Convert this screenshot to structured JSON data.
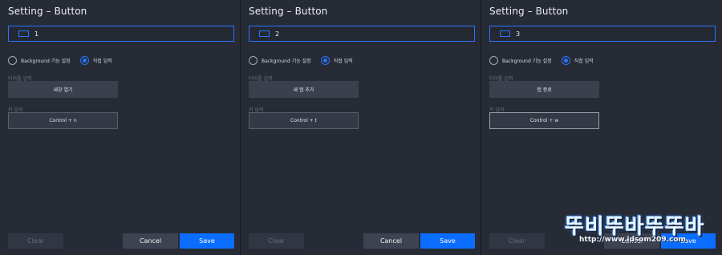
{
  "panels": [
    {
      "title": "Setting – Button",
      "button_id": "1",
      "radio_background": "Background 기능 설정",
      "radio_direct": "직접 입력",
      "title_label": "타이틀 입력",
      "title_value": "새창 열기",
      "key_label": "키 입력",
      "key_value": "Control + n",
      "clear": "Clear",
      "cancel": "Cancel",
      "save": "Save"
    },
    {
      "title": "Setting – Button",
      "button_id": "2",
      "radio_background": "Background 기능 설정",
      "radio_direct": "직접 입력",
      "title_label": "타이틀 입력",
      "title_value": "새 탭 추가",
      "key_label": "키 입력",
      "key_value": "Control + t",
      "clear": "Clear",
      "cancel": "Cancel",
      "save": "Save"
    },
    {
      "title": "Setting – Button",
      "button_id": "3",
      "radio_background": "Background 기능 설정",
      "radio_direct": "직접 입력",
      "title_label": "타이틀 입력",
      "title_value": "탭 종료",
      "key_label": "키 입력",
      "key_value": "Control + w",
      "clear": "Clear",
      "cancel": "Cancel",
      "save": "Save"
    }
  ],
  "watermark": {
    "logo_text": "뚜비뚜바뚜뚜바",
    "url": "http://www.idsom209.com"
  },
  "colors": {
    "panel_bg": "#262b35",
    "accent": "#2a74ff",
    "save": "#0a6dff"
  }
}
